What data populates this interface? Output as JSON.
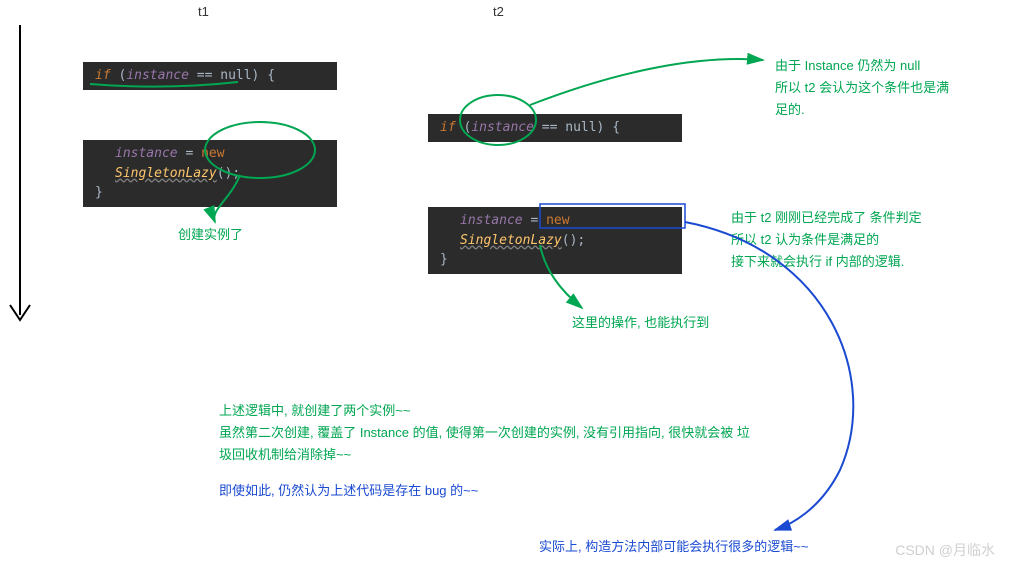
{
  "columns": {
    "t1": {
      "label": "t1"
    },
    "t2": {
      "label": "t2"
    }
  },
  "code": {
    "if_kw": "if",
    "instance": "instance",
    "eq_null": " == null) {",
    "assign": " = ",
    "new_kw": "new",
    "cls": "SingletonLazy",
    "paren": "();",
    "close_brace": "}",
    "open_paren": " ("
  },
  "annotations": {
    "a1_l1": "由于 Instance 仍然为 null",
    "a1_l2": "所以 t2 会认为这个条件也是满",
    "a1_l3": "足的.",
    "a2": "创建实例了",
    "a3_l1": "由于 t2 刚刚已经完成了 条件判定",
    "a3_l2": "所以 t2 认为条件是满足的",
    "a3_l3": "接下来就会执行 if 内部的逻辑.",
    "a4": "这里的操作, 也能执行到",
    "a5_l1": "上述逻辑中, 就创建了两个实例~~",
    "a5_l2": "虽然第二次创建, 覆盖了 Instance 的值, 使得第一次创建的实例, 没有引用指向, 很快就会被 垃",
    "a5_l3": "圾回收机制给消除掉~~",
    "a6": "即使如此, 仍然认为上述代码是存在 bug 的~~",
    "a7": "实际上, 构造方法内部可能会执行很多的逻辑~~"
  },
  "watermark": "CSDN @月临水"
}
